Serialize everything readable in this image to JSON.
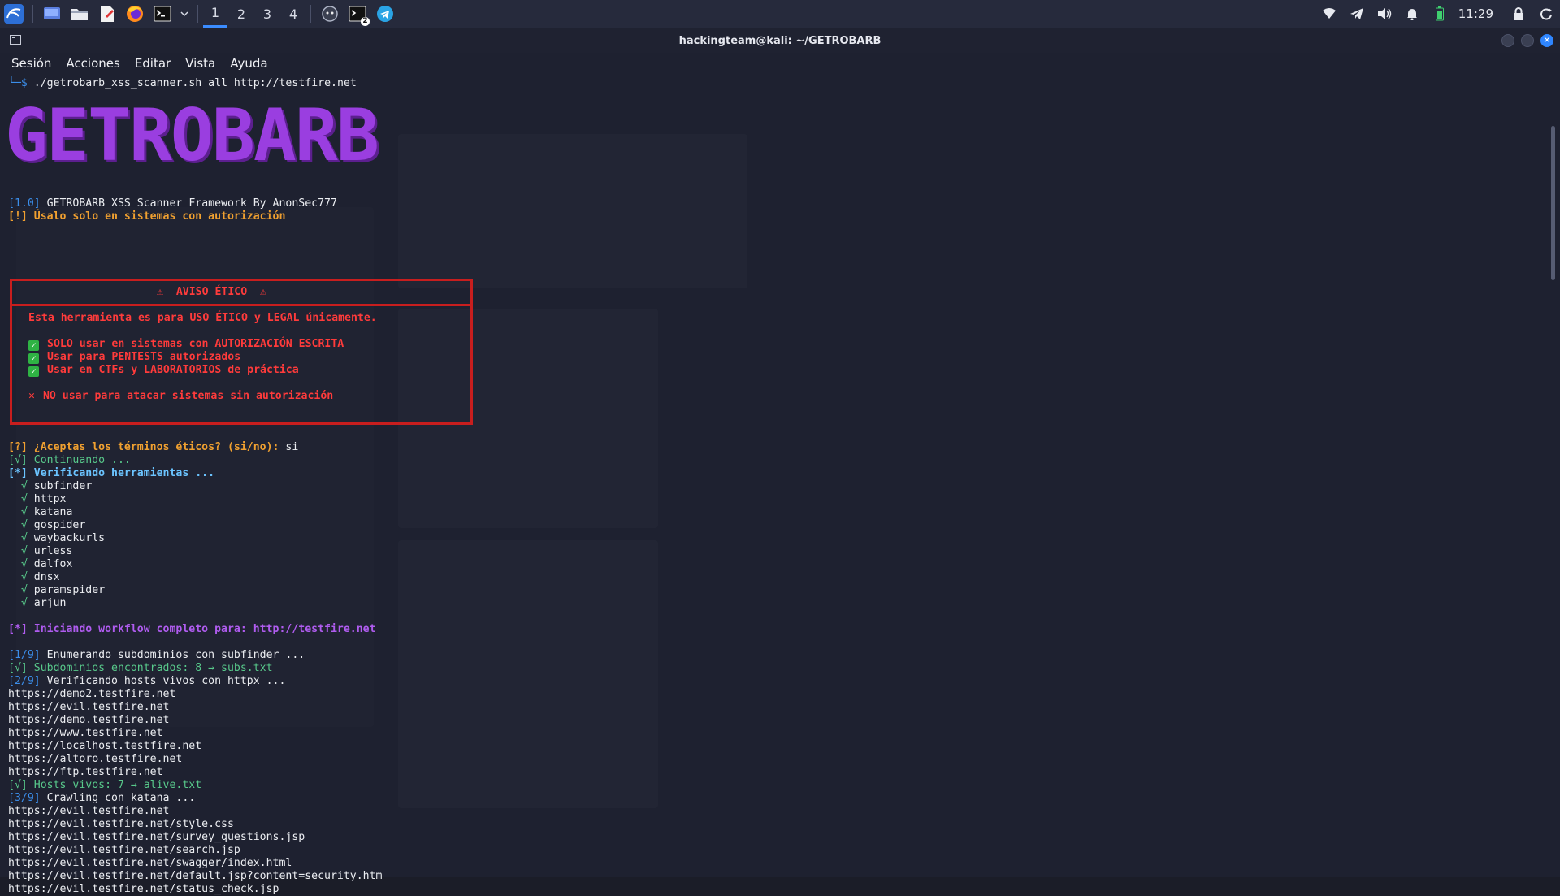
{
  "taskbar": {
    "workspaces": [
      "1",
      "2",
      "3",
      "4"
    ],
    "active_workspace": "1",
    "clock": "11:29",
    "terminal_badge": "2",
    "accent_color": "#3b8cff"
  },
  "window": {
    "title": "hackingteam@kali: ~/GETROBARB",
    "menu": [
      "Sesión",
      "Acciones",
      "Editar",
      "Vista",
      "Ayuda"
    ]
  },
  "terminal": {
    "prompt_prefix": "└─$",
    "command_script": "./getrobarb_xss_scanner.sh",
    "command_args": " all http://testfire.net",
    "banner": "GETROBARB",
    "version_tag": "[1.0]",
    "version_text": " GETROBARB XSS Scanner Framework By AnonSec777",
    "warning": "[!] Úsalo solo en sistemas con autorización",
    "ethics": {
      "title": "⚠  AVISO ÉTICO  ⚠",
      "intro": "Esta herramienta es para USO ÉTICO y LEGAL únicamente.",
      "allowed": [
        "SOLO usar en sistemas con AUTORIZACIÓN ESCRITA",
        "Usar para PENTESTS autorizados",
        "Usar en CTFs y LABORATORIOS de práctica"
      ],
      "forbidden": "NO usar para atacar sistemas sin autorización"
    },
    "accept_question": "[?] ¿Aceptas los términos éticos? (si/no):",
    "accept_answer": " si",
    "continuing": "[√] Continuando ...",
    "verifying_tools": "[*] Verificando herramientas ...",
    "tools": [
      "subfinder",
      "httpx",
      "katana",
      "gospider",
      "waybackurls",
      "urless",
      "dalfox",
      "dnsx",
      "paramspider",
      "arjun"
    ],
    "workflow": "[*] Iniciando workflow completo para: http://testfire.net",
    "step1_tag": "[1/9]",
    "step1_text": " Enumerando subdominios con subfinder ...",
    "step1_result": "[√] Subdominios encontrados: 8 → subs.txt",
    "step2_tag": "[2/9]",
    "step2_text": " Verificando hosts vivos con httpx ...",
    "hosts": [
      "https://demo2.testfire.net",
      "https://evil.testfire.net",
      "https://demo.testfire.net",
      "https://www.testfire.net",
      "https://localhost.testfire.net",
      "https://altoro.testfire.net",
      "https://ftp.testfire.net"
    ],
    "step2_result": "[√] Hosts vivos: 7 → alive.txt",
    "step3_tag": "[3/9]",
    "step3_text": " Crawling con katana ...",
    "crawl": [
      "https://evil.testfire.net",
      "https://evil.testfire.net/style.css",
      "https://evil.testfire.net/survey_questions.jsp",
      "https://evil.testfire.net/search.jsp",
      "https://evil.testfire.net/swagger/index.html",
      "https://evil.testfire.net/default.jsp?content=security.htm",
      "https://evil.testfire.net/status_check.jsp"
    ]
  }
}
